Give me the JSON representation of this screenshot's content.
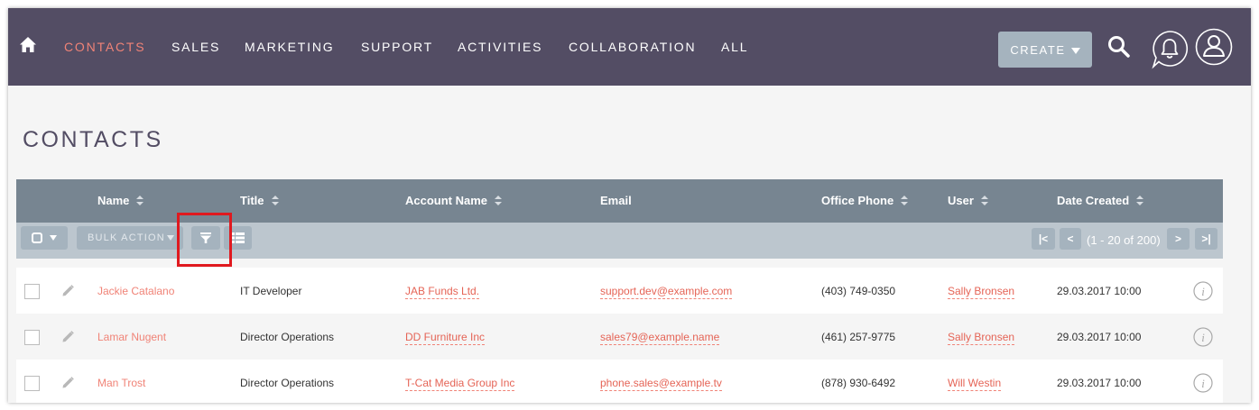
{
  "nav": {
    "home_icon": "home-icon",
    "items": [
      "CONTACTS",
      "SALES",
      "MARKETING",
      "SUPPORT",
      "ACTIVITIES",
      "COLLABORATION",
      "ALL"
    ],
    "active": "CONTACTS",
    "create_label": "CREATE",
    "icons": [
      "search-icon",
      "notification-bell-icon",
      "user-profile-icon"
    ]
  },
  "page": {
    "title": "CONTACTS"
  },
  "colors": {
    "nav_bg": "#534d64",
    "active_link": "#f08377",
    "header_bg": "#778591",
    "toolbar_bg": "#bcc6ce",
    "button_bg": "#a5b3be",
    "highlight": "#e0191f"
  },
  "table": {
    "columns": [
      "Name",
      "Title",
      "Account Name",
      "Email",
      "Office Phone",
      "User",
      "Date Created"
    ],
    "toolbar": {
      "bulk_action_label": "BULK ACTION",
      "pagination": {
        "first": "|<",
        "prev": "<",
        "info": "(1 - 20 of 200)",
        "next": ">",
        "last": ">|"
      }
    },
    "rows": [
      {
        "name": "Jackie Catalano",
        "title": "IT Developer",
        "account": "JAB Funds Ltd.",
        "email": "support.dev@example.com",
        "phone": "(403) 749-0350",
        "user": "Sally Bronsen",
        "date": "29.03.2017 10:00"
      },
      {
        "name": "Lamar Nugent",
        "title": "Director Operations",
        "account": "DD Furniture Inc",
        "email": "sales79@example.name",
        "phone": "(461) 257-9775",
        "user": "Sally Bronsen",
        "date": "29.03.2017 10:00"
      },
      {
        "name": "Man Trost",
        "title": "Director Operations",
        "account": "T-Cat Media Group Inc",
        "email": "phone.sales@example.tv",
        "phone": "(878) 930-6492",
        "user": "Will Westin",
        "date": "29.03.2017 10:00"
      }
    ]
  }
}
